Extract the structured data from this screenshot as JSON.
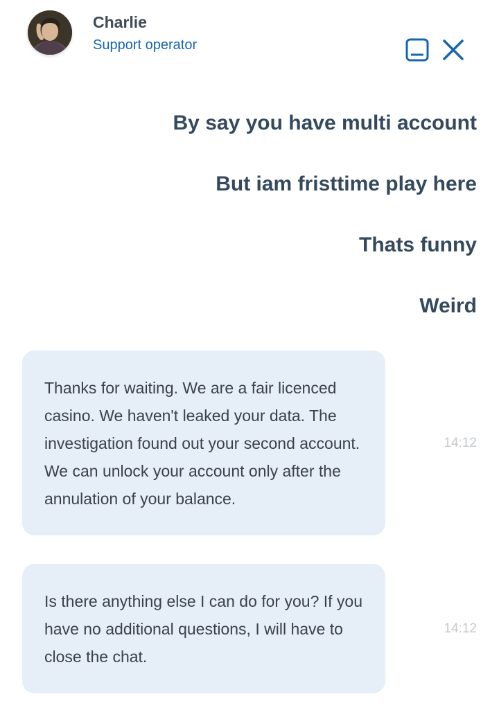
{
  "header": {
    "agent_name": "Charlie",
    "agent_role": "Support operator",
    "avatar_icon": "avatar-photo",
    "minimize_icon": "minimize-icon",
    "close_icon": "close-icon",
    "accent_color": "#1565b5"
  },
  "user_messages": [
    "By say you have multi account",
    "But iam fristtime play here",
    "Thats funny",
    "Weird"
  ],
  "operator_messages": [
    {
      "text": "Thanks for waiting. We are a fair licenced casino. We haven't leaked your data. The investigation found out your second account. We can unlock your account only after the annulation of your balance.",
      "time": "14:12"
    },
    {
      "text": "Is there anything else I can do for you? If you have no additional questions, I will have to close the chat.",
      "time": "14:12"
    }
  ],
  "colors": {
    "bubble_background": "#e6eef7",
    "user_text": "#34495e",
    "timestamp": "#c5c9cd"
  }
}
